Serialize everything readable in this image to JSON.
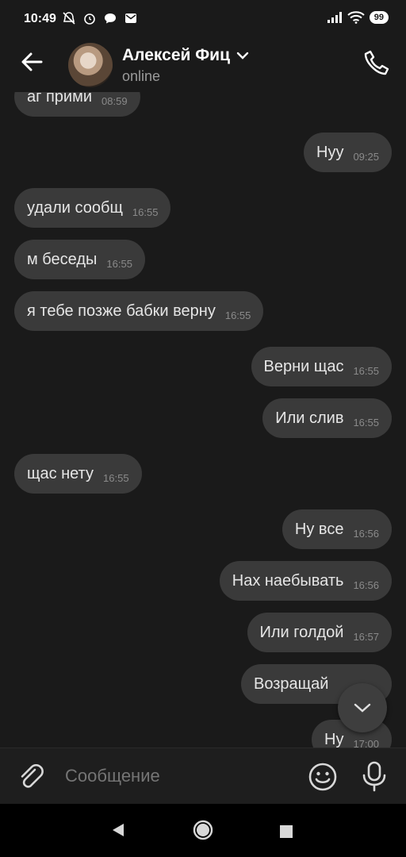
{
  "statusbar": {
    "time": "10:49",
    "battery": "99"
  },
  "header": {
    "contact_name": "Алексей Фиц",
    "status": "online"
  },
  "messages": [
    {
      "direction": "in",
      "text": "аг прими",
      "time": "08:59"
    },
    {
      "direction": "out",
      "text": "Нуу",
      "time": "09:25"
    },
    {
      "direction": "in",
      "text": "удали сообщ",
      "time": "16:55"
    },
    {
      "direction": "in",
      "text": "м беседы",
      "time": "16:55"
    },
    {
      "direction": "in",
      "text": "я тебе позже бабки верну",
      "time": "16:55"
    },
    {
      "direction": "out",
      "text": "Верни щас",
      "time": "16:55"
    },
    {
      "direction": "out",
      "text": "Или слив",
      "time": "16:55"
    },
    {
      "direction": "in",
      "text": "щас нету",
      "time": "16:55"
    },
    {
      "direction": "out",
      "text": "Ну все",
      "time": "16:56"
    },
    {
      "direction": "out",
      "text": "Нах наебывать",
      "time": "16:56"
    },
    {
      "direction": "out",
      "text": "Или голдой",
      "time": "16:57"
    },
    {
      "direction": "out",
      "text": "Возращай",
      "time": ""
    },
    {
      "direction": "out",
      "text": "Ну",
      "time": "17:00"
    }
  ],
  "composer": {
    "placeholder": "Сообщение"
  },
  "icons": {
    "back": "arrow-left-icon",
    "dropdown": "chevron-down-icon",
    "call": "phone-icon",
    "attach": "paperclip-icon",
    "emoji": "smiley-icon",
    "mic": "microphone-icon",
    "scroll": "chevron-down-icon"
  },
  "colors": {
    "background": "#1a1a1a",
    "bubble": "#3a3a3a",
    "time_text": "#8a8a8a"
  }
}
